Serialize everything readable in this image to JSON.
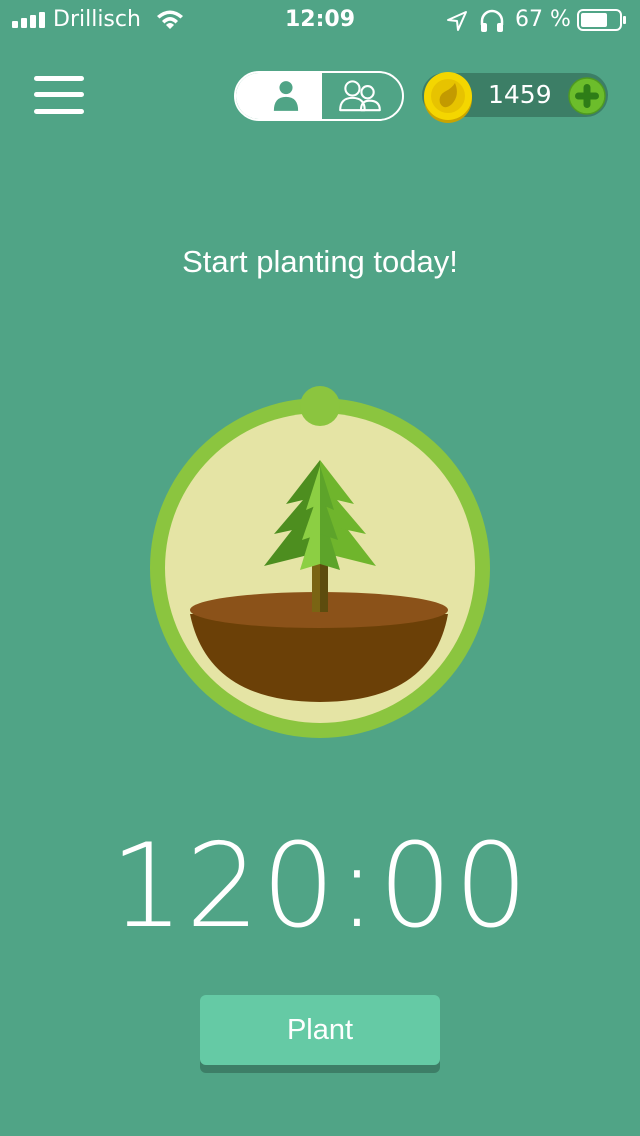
{
  "status_bar": {
    "carrier": "Drillisch",
    "time": "12:09",
    "battery_percent_label": "67 %",
    "battery_level": 0.67
  },
  "header": {
    "coins": "1459"
  },
  "main": {
    "prompt": "Start planting today!",
    "timer": "120:00",
    "plant_label": "Plant"
  },
  "colors": {
    "background": "#50a486",
    "button": "#65caa5",
    "ring": "#8bc53f",
    "coin": "#f4d600"
  },
  "icons": [
    "signal-icon",
    "wifi-icon",
    "location-icon",
    "headphones-icon",
    "battery-icon",
    "menu-icon",
    "person-icon",
    "group-icon",
    "coin-icon",
    "plus-icon"
  ]
}
